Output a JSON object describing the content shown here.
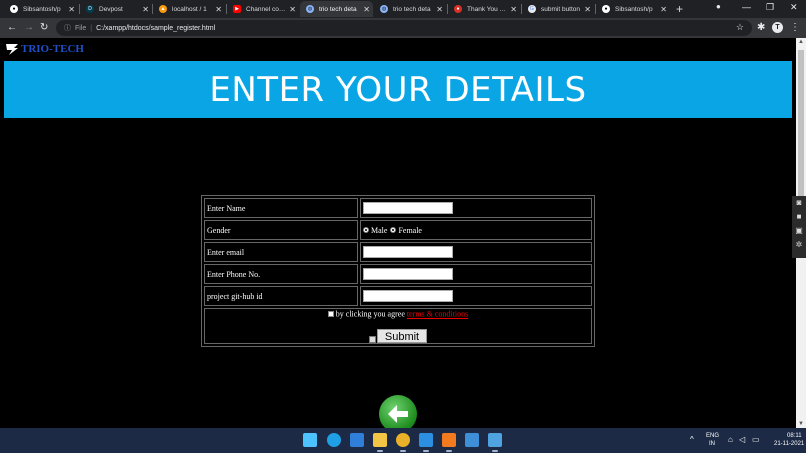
{
  "browser": {
    "tabs": [
      {
        "title": "Sibsantosh/p",
        "icon": "github-icon",
        "color": "#ffffff",
        "active": false
      },
      {
        "title": "Devpost",
        "icon": "devpost-icon",
        "color": "#003e54",
        "active": false
      },
      {
        "title": "localhost / 1",
        "icon": "phpmyadmin-icon",
        "color": "#f89c0e",
        "active": false
      },
      {
        "title": "Channel conte",
        "icon": "youtube-icon",
        "color": "#ff0000",
        "active": false
      },
      {
        "title": "trio tech deta",
        "icon": "globe-icon",
        "color": "#8ab4f8",
        "active": true
      },
      {
        "title": "trio tech deta",
        "icon": "globe-icon",
        "color": "#8ab4f8",
        "active": false
      },
      {
        "title": "Thank You For",
        "icon": "record-icon",
        "color": "#d93025",
        "active": false
      },
      {
        "title": "submit button",
        "icon": "google-icon",
        "color": "#8ab4f8",
        "active": false
      },
      {
        "title": "Sibsantosh/p",
        "icon": "github-icon",
        "color": "#ffffff",
        "active": false
      }
    ],
    "new_tab": "+",
    "window_controls": {
      "minimize": "—",
      "restore": "❐",
      "close": "✕"
    },
    "address": {
      "scheme_label": "File",
      "url": "C:/xampp/htdocs/sample_register.html"
    },
    "profile_initial": "T"
  },
  "page": {
    "brand": {
      "name": "TRIO-TECH"
    },
    "banner_title": "ENTER YOUR DETAILS",
    "form": {
      "name_label": "Enter Name",
      "gender_label": "Gender",
      "gender_male": "Male",
      "gender_female": "Female",
      "email_label": "Enter email",
      "phone_label": "Enter Phone No.",
      "github_label": "project git-hub id",
      "agree_text": "by clicking you agree",
      "terms_link": "terms & conditions",
      "submit_label": "Submit"
    }
  },
  "taskbar": {
    "apps": [
      {
        "name": "windows-start-icon",
        "color": "#4cc2ff"
      },
      {
        "name": "edge-icon",
        "color": "#1fa0e4"
      },
      {
        "name": "mail-icon",
        "color": "#2f7fd8"
      },
      {
        "name": "file-explorer-icon",
        "color": "#f3c545"
      },
      {
        "name": "chrome-icon",
        "color": "#e9b02a"
      },
      {
        "name": "vscode-icon",
        "color": "#2c8fe0"
      },
      {
        "name": "xampp-icon",
        "color": "#f47a20"
      },
      {
        "name": "photos-icon",
        "color": "#3d8fd8"
      },
      {
        "name": "image-app-icon",
        "color": "#4fa3e0"
      }
    ],
    "tray": {
      "language": "ENG",
      "region": "IN",
      "time": "08:11",
      "date": "21-11-2021"
    }
  }
}
